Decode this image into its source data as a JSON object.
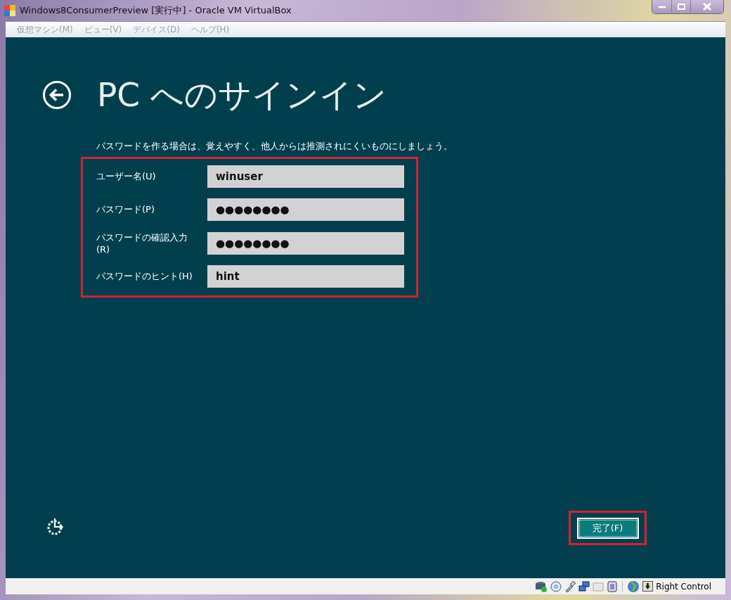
{
  "window": {
    "title": "Windows8ConsumerPreview [実行中] - Oracle VM VirtualBox"
  },
  "menu": [
    {
      "label": "仮想マシン(M)",
      "disabled": true
    },
    {
      "label": "ビュー(V)",
      "disabled": true
    },
    {
      "label": "デバイス(D)",
      "disabled": true
    },
    {
      "label": "ヘルプ(H)",
      "disabled": true
    }
  ],
  "screen": {
    "heading": "PC へのサインイン",
    "instruction": "パスワードを作る場合は、覚えやすく、他人からは推測されにくいものにしましょう。",
    "fields": [
      {
        "label": "ユーザー名(U)",
        "value": "winuser"
      },
      {
        "label": "パスワード(P)",
        "value": "●●●●●●●●"
      },
      {
        "label": "パスワードの確認入力(R)",
        "value": "●●●●●●●●"
      },
      {
        "label": "パスワードのヒント(H)",
        "value": "hint"
      }
    ],
    "finish_button": "完了(F)"
  },
  "status_bar": {
    "host_key": "Right Control"
  }
}
